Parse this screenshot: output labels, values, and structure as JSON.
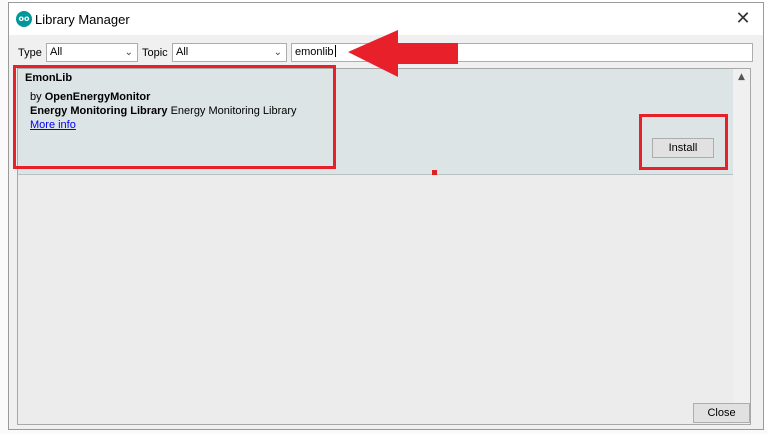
{
  "window": {
    "title": "Library Manager",
    "app_icon_text": "oo",
    "close_glyph": "✕"
  },
  "filters": {
    "type_label": "Type",
    "type_value": "All",
    "topic_label": "Topic",
    "topic_value": "All",
    "search_value": "emonlib",
    "dropdown_glyph": "⌄"
  },
  "library": {
    "name": "EmonLib",
    "by_prefix": "by",
    "author": "OpenEnergyMonitor",
    "sentence": "Energy Monitoring Library",
    "paragraph": "Energy Monitoring Library",
    "more_info": "More info",
    "install_label": "Install"
  },
  "scrollbar": {
    "up_glyph": "▲",
    "down_glyph": "▼"
  },
  "footer": {
    "close_label": "Close"
  },
  "annotations": {
    "highlight_color": "#e8202a"
  },
  "colors": {
    "accent": "#00979c",
    "item_background": "#dde4e5",
    "link": "#0000ee"
  }
}
